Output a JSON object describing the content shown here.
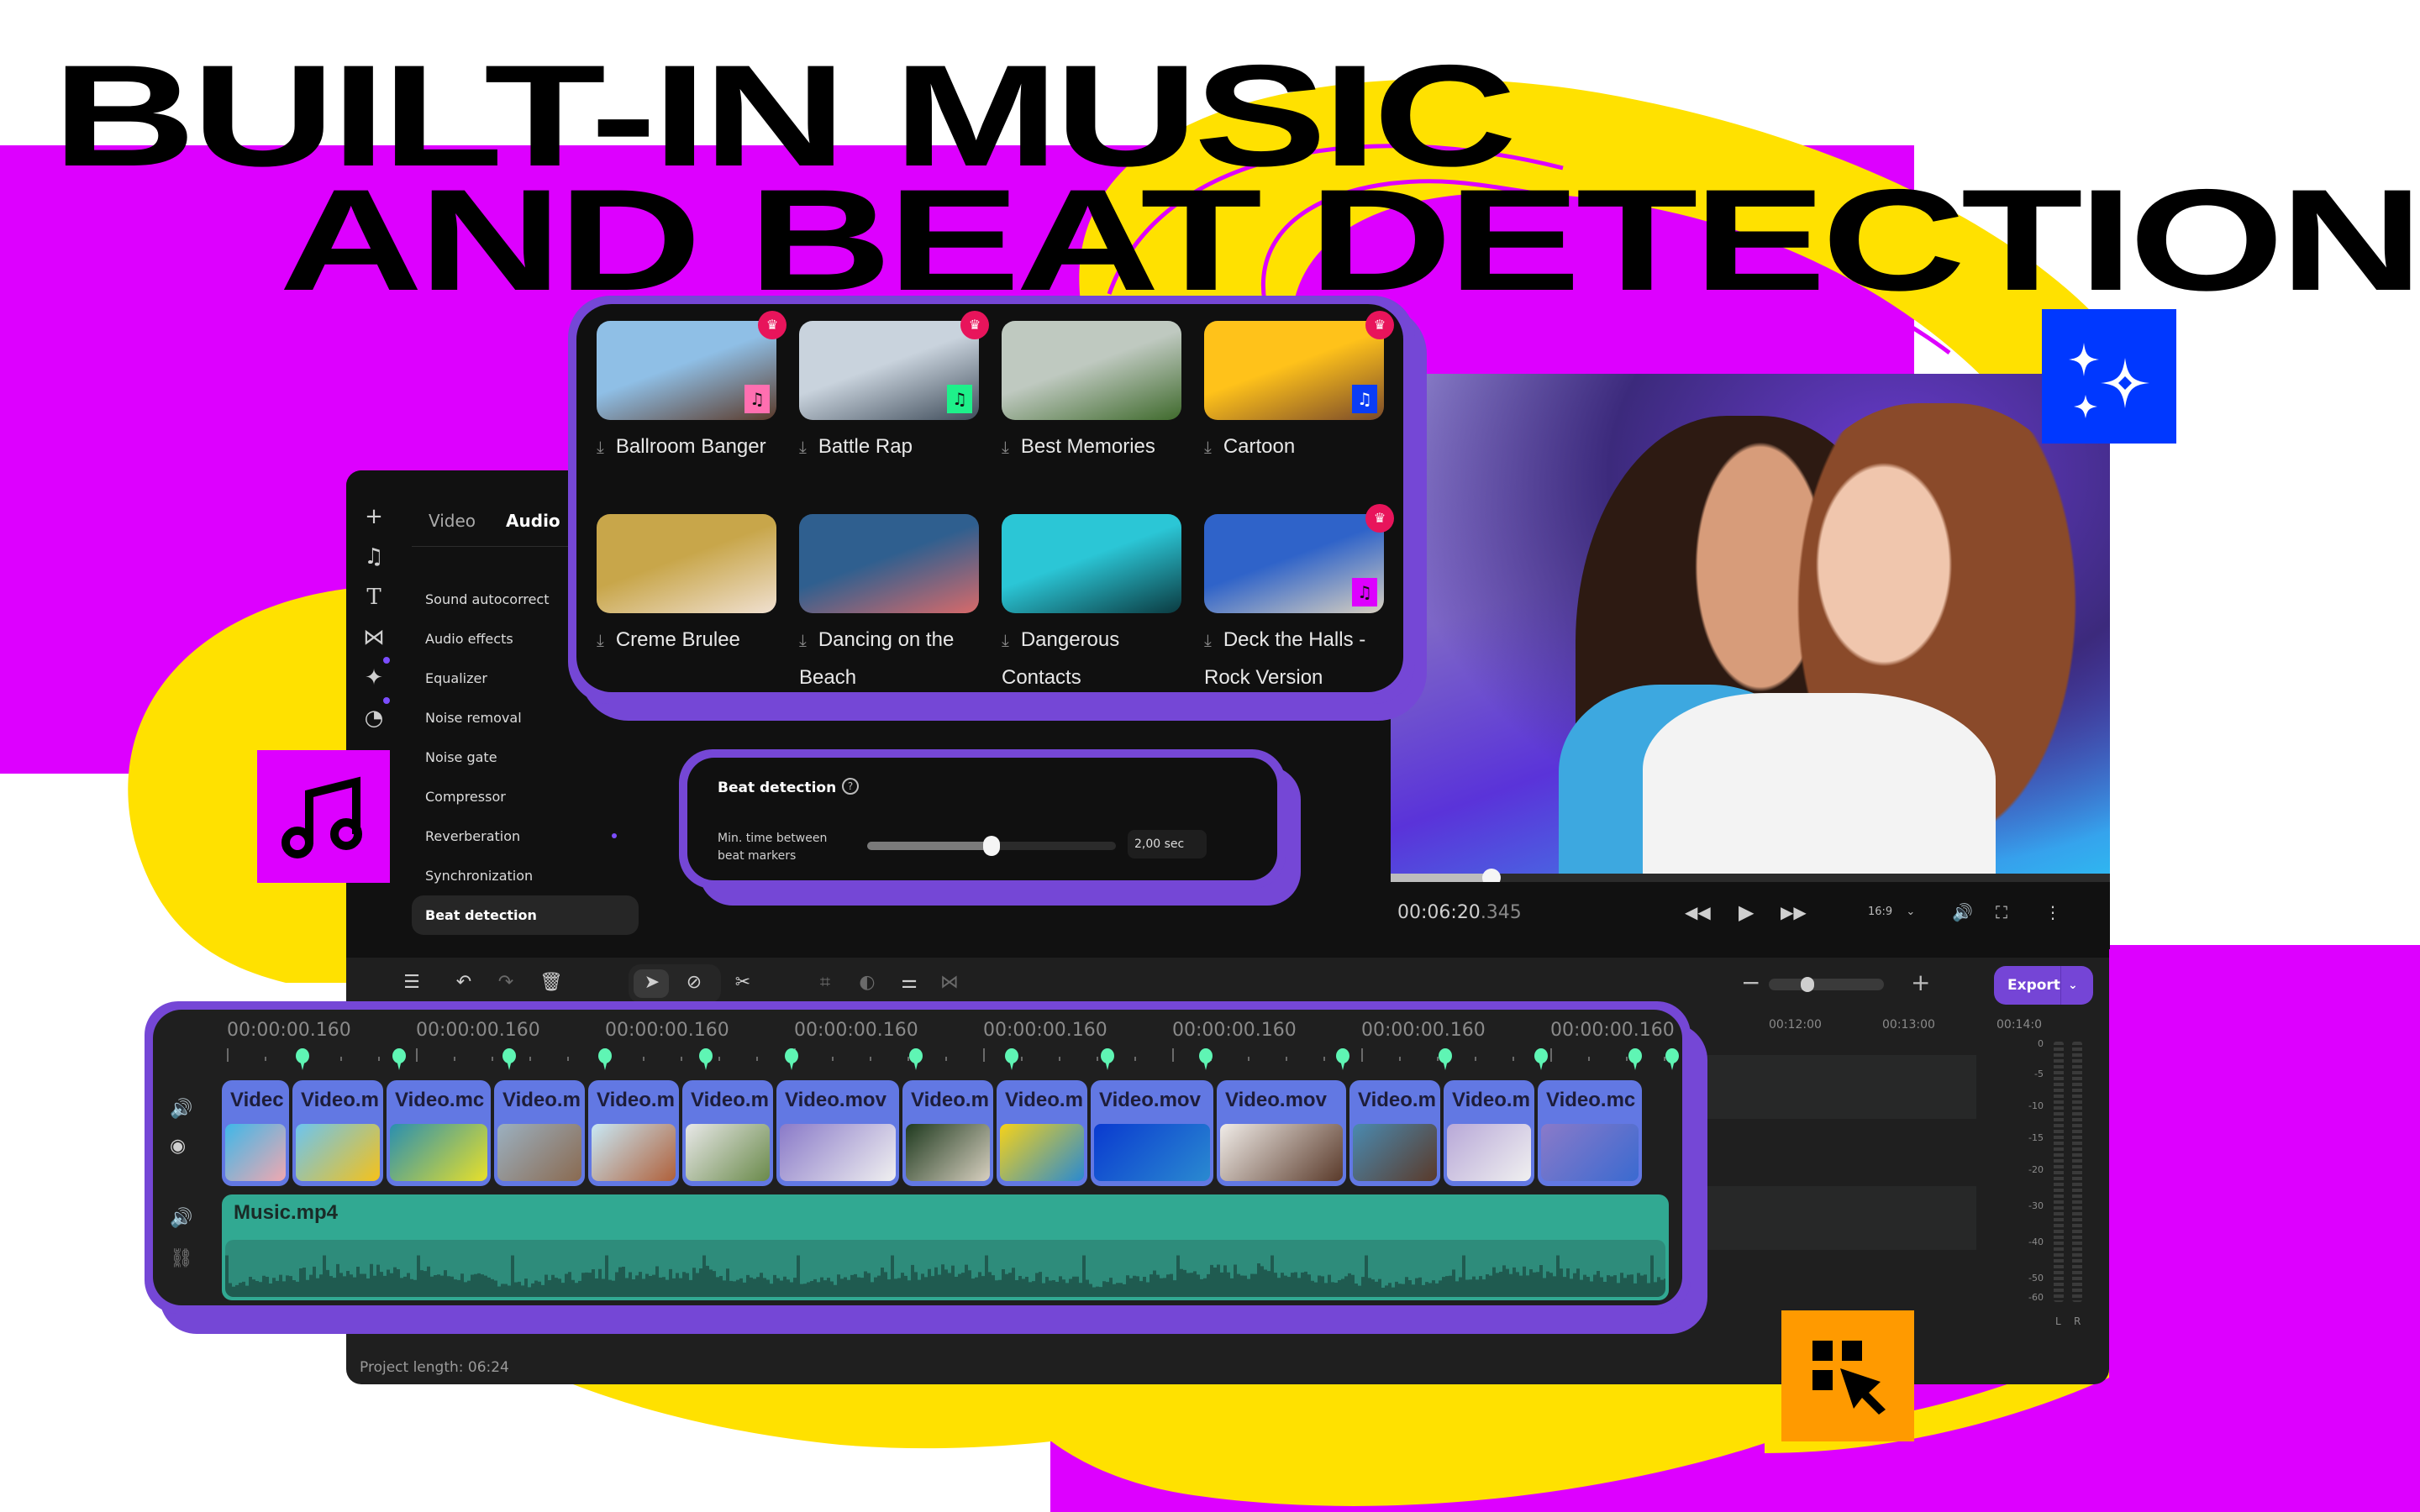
{
  "headline": {
    "line1": "BUILT-IN MUSIC",
    "line2": "AND BEAT DETECTION"
  },
  "colors": {
    "magenta": "#dd00ff",
    "yellow": "#ffe100",
    "accent_purple": "#7547d6",
    "beat_marker_green": "#5ff5b4",
    "clip_blue": "#6278e3",
    "music_teal": "#31a992",
    "feature_blue": "#0038ff",
    "feature_orange": "#ff9a00",
    "premium_crown": "#e8145b"
  },
  "feature_icons": [
    {
      "name": "sparkles-icon",
      "tile_color": "#0038ff"
    },
    {
      "name": "music-note-icon",
      "tile_color": "#dd00ff"
    },
    {
      "name": "select-cursor-icon",
      "tile_color": "#ff9a00"
    }
  ],
  "sidebar": {
    "rail_icons": [
      "plus-icon",
      "music-icon",
      "text-icon",
      "transitions-icon",
      "magic-icon",
      "stickers-icon"
    ],
    "tabs": [
      {
        "label": "Video",
        "active": false
      },
      {
        "label": "Audio",
        "active": true
      }
    ],
    "items": [
      {
        "label": "Sound autocorrect"
      },
      {
        "label": "Audio effects"
      },
      {
        "label": "Equalizer"
      },
      {
        "label": "Noise removal"
      },
      {
        "label": "Noise gate"
      },
      {
        "label": "Compressor"
      },
      {
        "label": "Reverberation",
        "has_dot": true
      },
      {
        "label": "Synchronization"
      },
      {
        "label": "Beat detection",
        "active": true
      }
    ]
  },
  "music_library": {
    "tracks": [
      {
        "title": "Ballroom Banger",
        "premium": true,
        "badge_color": "#ff6fb0",
        "thumb": [
          "#8fbfe6",
          "#5b3a2a"
        ]
      },
      {
        "title": "Battle Rap",
        "premium": true,
        "badge_color": "#1ef08a",
        "thumb": [
          "#c9d3dd",
          "#3f4c5a"
        ]
      },
      {
        "title": "Best Memories",
        "premium": false,
        "badge_color": null,
        "thumb": [
          "#bfc9c0",
          "#3f6a2c"
        ]
      },
      {
        "title": "Cartoon",
        "premium": true,
        "badge_color": "#0a3df5",
        "thumb": [
          "#ffc21a",
          "#7a4a2a"
        ]
      },
      {
        "title": "Creme Brulee",
        "premium": false,
        "badge_color": null,
        "thumb": [
          "#c8a64a",
          "#f0e0d0"
        ]
      },
      {
        "title": "Dancing on the Beach",
        "premium": false,
        "badge_color": null,
        "thumb": [
          "#2f5f8f",
          "#d86a6a"
        ]
      },
      {
        "title": "Dangerous Contacts",
        "premium": false,
        "badge_color": null,
        "thumb": [
          "#2bc6d6",
          "#0b3a40"
        ]
      },
      {
        "title": "Deck the Halls - Rock Version",
        "premium": true,
        "badge_color": "#dd00ff",
        "thumb": [
          "#2f63c9",
          "#d8d0c0"
        ]
      }
    ]
  },
  "beat_detection": {
    "title": "Beat detection",
    "help_icon": "question-circle-icon",
    "min_time_label": "Min. time between beat markers",
    "slider_fraction": 0.5,
    "value": "2,00 sec"
  },
  "player": {
    "timecode_main": "00:06:20",
    "timecode_ms": ".345",
    "progress_fraction": 0.14,
    "aspect_ratio": "16:9",
    "controls": [
      "rewind-icon",
      "play-icon",
      "fast-forward-icon",
      "volume-icon",
      "fullscreen-icon",
      "more-icon"
    ]
  },
  "toolbar": {
    "tools": [
      "add-track-icon",
      "undo-icon",
      "redo-icon",
      "delete-icon",
      "select-icon",
      "snap-icon",
      "cut-icon",
      "crop-icon",
      "color-icon",
      "adjust-icon",
      "transition-icon"
    ],
    "zoom_fraction": 0.28,
    "export_label": "Export"
  },
  "timeline": {
    "ruler_labels": [
      "00:00:00.160",
      "00:00:00.160",
      "00:00:00.160",
      "00:00:00.160",
      "00:00:00.160",
      "00:00:00.160",
      "00:00:00.160",
      "00:00:00.160"
    ],
    "ruler_labels_right": [
      "00:12:00",
      "00:13:00",
      "00:14:0"
    ],
    "beat_marker_count": 15,
    "video_clips": [
      {
        "name": "Videc",
        "thumb": [
          "#3fb7e8",
          "#f0a8b0"
        ]
      },
      {
        "name": "Video.m",
        "thumb": [
          "#6cc4f0",
          "#f5c21a"
        ]
      },
      {
        "name": "Video.mc",
        "thumb": [
          "#2a8fb0",
          "#e8e02a"
        ]
      },
      {
        "name": "Video.m",
        "thumb": [
          "#9bb0c0",
          "#8a6a50"
        ]
      },
      {
        "name": "Video.m",
        "thumb": [
          "#c8e8f5",
          "#b0603a"
        ]
      },
      {
        "name": "Video.m",
        "thumb": [
          "#e8e8e8",
          "#6a8a4a"
        ]
      },
      {
        "name": "Video.mov",
        "thumb": [
          "#8a7ac9",
          "#f0f0f0"
        ]
      },
      {
        "name": "Video.m",
        "thumb": [
          "#1f3a1f",
          "#d8d0c0"
        ]
      },
      {
        "name": "Video.m",
        "thumb": [
          "#f5d21a",
          "#2a8ad0"
        ]
      },
      {
        "name": "Video.mov",
        "thumb": [
          "#0a3ad0",
          "#2a8ad0"
        ]
      },
      {
        "name": "Video.mov",
        "thumb": [
          "#f0ece8",
          "#5a3a2a"
        ]
      },
      {
        "name": "Video.m",
        "thumb": [
          "#4a8ab0",
          "#5a3a2a"
        ]
      },
      {
        "name": "Video.m",
        "thumb": [
          "#b8a8d8",
          "#f0f0f0"
        ]
      },
      {
        "name": "Video.mc",
        "thumb": [
          "#8a7ac9",
          "#3a6ad0"
        ]
      }
    ],
    "music_clip": {
      "name": "Music.mp4"
    },
    "track_controls": {
      "video": [
        "volume-icon",
        "eye-icon"
      ],
      "audio": [
        "volume-icon",
        "unlink-icon"
      ]
    }
  },
  "level_meter": {
    "labels": [
      "0",
      "-5",
      "-10",
      "-15",
      "-20",
      "-30",
      "-40",
      "-50",
      "-60"
    ],
    "channels": [
      "L",
      "R"
    ]
  },
  "status": {
    "project_length": "Project length: 06:24"
  }
}
